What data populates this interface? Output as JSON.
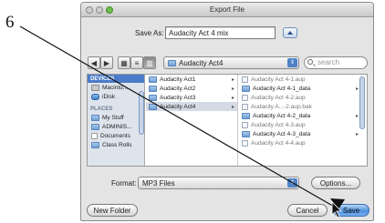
{
  "callout": {
    "number": "6"
  },
  "window": {
    "title": "Export File"
  },
  "save_as": {
    "label": "Save As:",
    "value": "Audacity Act 4 mix"
  },
  "toolbar": {
    "back": "◀",
    "forward": "▶",
    "location": "Audacity Act4",
    "search_placeholder": "search"
  },
  "sidebar": {
    "devices_header": "DEVICES",
    "devices": [
      "Macinto...",
      "iDisk"
    ],
    "places_header": "PLACES",
    "places": [
      "My Stuff",
      "ADMINIS...",
      "Documents",
      "Class Rolls"
    ]
  },
  "column1": {
    "items": [
      "Audacity Act1",
      "Audacity Act2",
      "Audacity Act3",
      "Audacity Act4"
    ],
    "selected_index": 3
  },
  "column2": {
    "items": [
      {
        "name": "Audacity Act 4-1.aup",
        "kind": "file",
        "arrow": ""
      },
      {
        "name": "Audacity Act 4-1_data",
        "kind": "folder",
        "arrow": "▸"
      },
      {
        "name": "Audacity Act 4-2.aup",
        "kind": "file",
        "arrow": ""
      },
      {
        "name": "Audacity A...-2.aup.bak",
        "kind": "file",
        "arrow": ""
      },
      {
        "name": "Audacity Act 4-2_data",
        "kind": "folder",
        "arrow": "▸"
      },
      {
        "name": "Audacity Act 4-3.aup",
        "kind": "file",
        "arrow": ""
      },
      {
        "name": "Audacity Act 4-3_data",
        "kind": "folder",
        "arrow": "▸"
      },
      {
        "name": "Audacity Act 4-4.aup",
        "kind": "file",
        "arrow": ""
      }
    ]
  },
  "format": {
    "label": "Format:",
    "value": "MP3 Files"
  },
  "buttons": {
    "options": "Options...",
    "new_folder": "New Folder",
    "cancel": "Cancel",
    "save": "Save"
  },
  "colors": {
    "accent": "#4e8fdc",
    "sidebar_bg": "#dee4ec",
    "dialog_bg": "#e4e4e4"
  }
}
